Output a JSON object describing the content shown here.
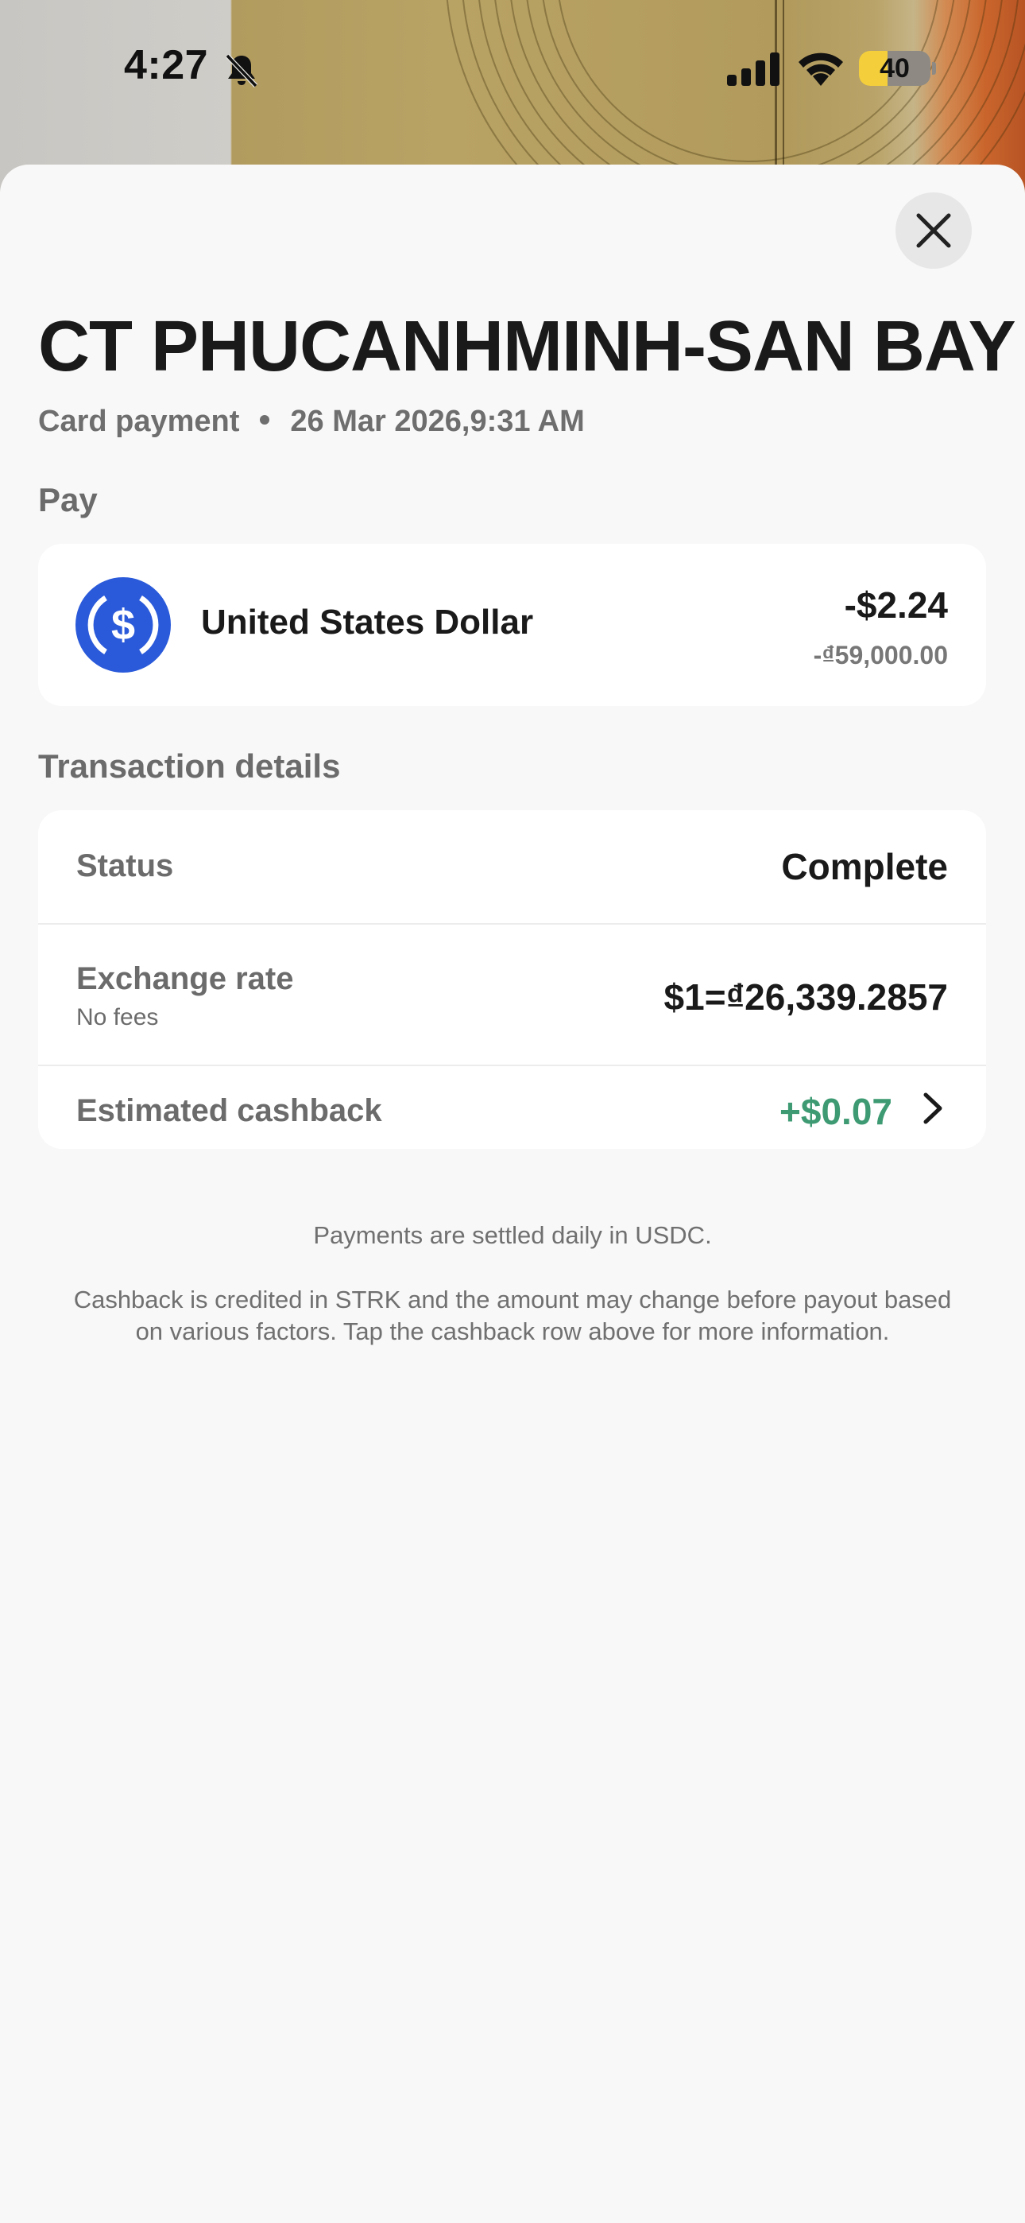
{
  "status_bar": {
    "time": "4:27",
    "battery_percent": "40",
    "battery_level": 0.4,
    "icons": [
      "bell-off-icon",
      "signal-icon",
      "wifi-icon",
      "battery-icon"
    ]
  },
  "header": {
    "merchant": "CT PHUCANHMINH-SAN BAY",
    "type": "Card payment",
    "datetime": "26 Mar 2026,9:31 AM",
    "close_icon": "close-icon"
  },
  "pay": {
    "section_label": "Pay",
    "currency_name": "United States Dollar",
    "currency_icon": "usdc-icon",
    "amount": "-$2.24",
    "local_amount": "-₫59,000.00"
  },
  "details": {
    "section_label": "Transaction details",
    "status_label": "Status",
    "status_value": "Complete",
    "exchange_label": "Exchange rate",
    "exchange_sub": "No fees",
    "exchange_value": "$1=₫26,339.2857",
    "cashback_label": "Estimated cashback",
    "cashback_value": "+$0.07",
    "cashback_icon": "chevron-right-icon"
  },
  "notes": {
    "settlement": "Payments are settled daily in USDC.",
    "cashback": "Cashback is credited in STRK and the amount may change before payout based on various factors. Tap the cashback row above for more information."
  },
  "colors": {
    "accent_green": "#3d9a72",
    "usdc_blue": "#2a5ada",
    "sheet_bg": "#f8f8f8",
    "battery_yellow": "#f4cf3b"
  }
}
